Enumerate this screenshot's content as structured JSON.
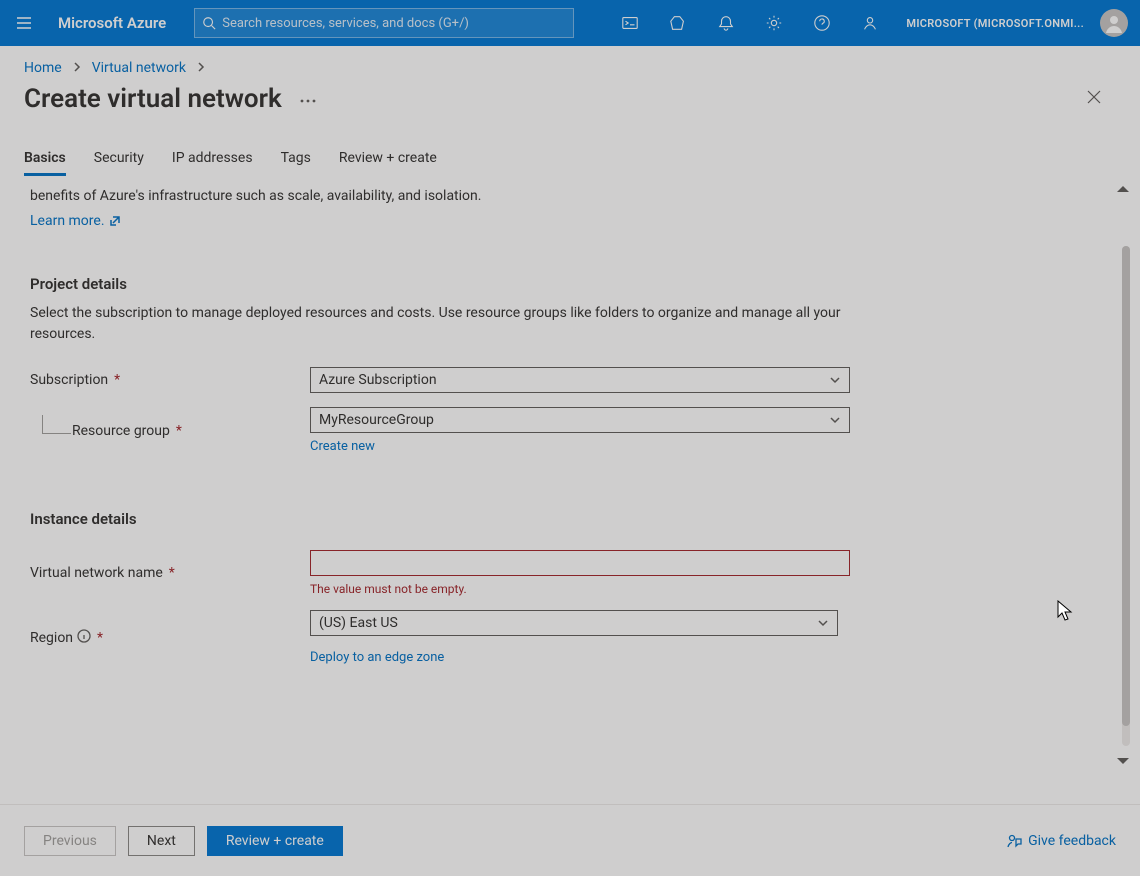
{
  "header": {
    "brand": "Microsoft Azure",
    "search_placeholder": "Search resources, services, and docs (G+/)",
    "account": "MICROSOFT (MICROSOFT.ONMI..."
  },
  "breadcrumb": {
    "home": "Home",
    "vnet": "Virtual network"
  },
  "page": {
    "title": "Create virtual network"
  },
  "tabs": {
    "basics": "Basics",
    "security": "Security",
    "ip": "IP addresses",
    "tags": "Tags",
    "review": "Review + create"
  },
  "intro": {
    "tail": "benefits of Azure's infrastructure such as scale, availability, and isolation.",
    "learn_more": "Learn more."
  },
  "sections": {
    "project": {
      "title": "Project details",
      "desc": "Select the subscription to manage deployed resources and costs. Use resource groups like folders to organize and manage all your resources."
    },
    "instance": {
      "title": "Instance details"
    }
  },
  "fields": {
    "subscription": {
      "label": "Subscription",
      "value": "Azure Subscription"
    },
    "resource_group": {
      "label": "Resource group",
      "value": "MyResourceGroup",
      "create_new": "Create new"
    },
    "vnet_name": {
      "label": "Virtual network name",
      "value": "",
      "error": "The value must not be empty."
    },
    "region": {
      "label": "Region",
      "value": "(US) East US",
      "edge_link": "Deploy to an edge zone"
    }
  },
  "footer": {
    "previous": "Previous",
    "next": "Next",
    "review": "Review + create",
    "feedback": "Give feedback"
  }
}
